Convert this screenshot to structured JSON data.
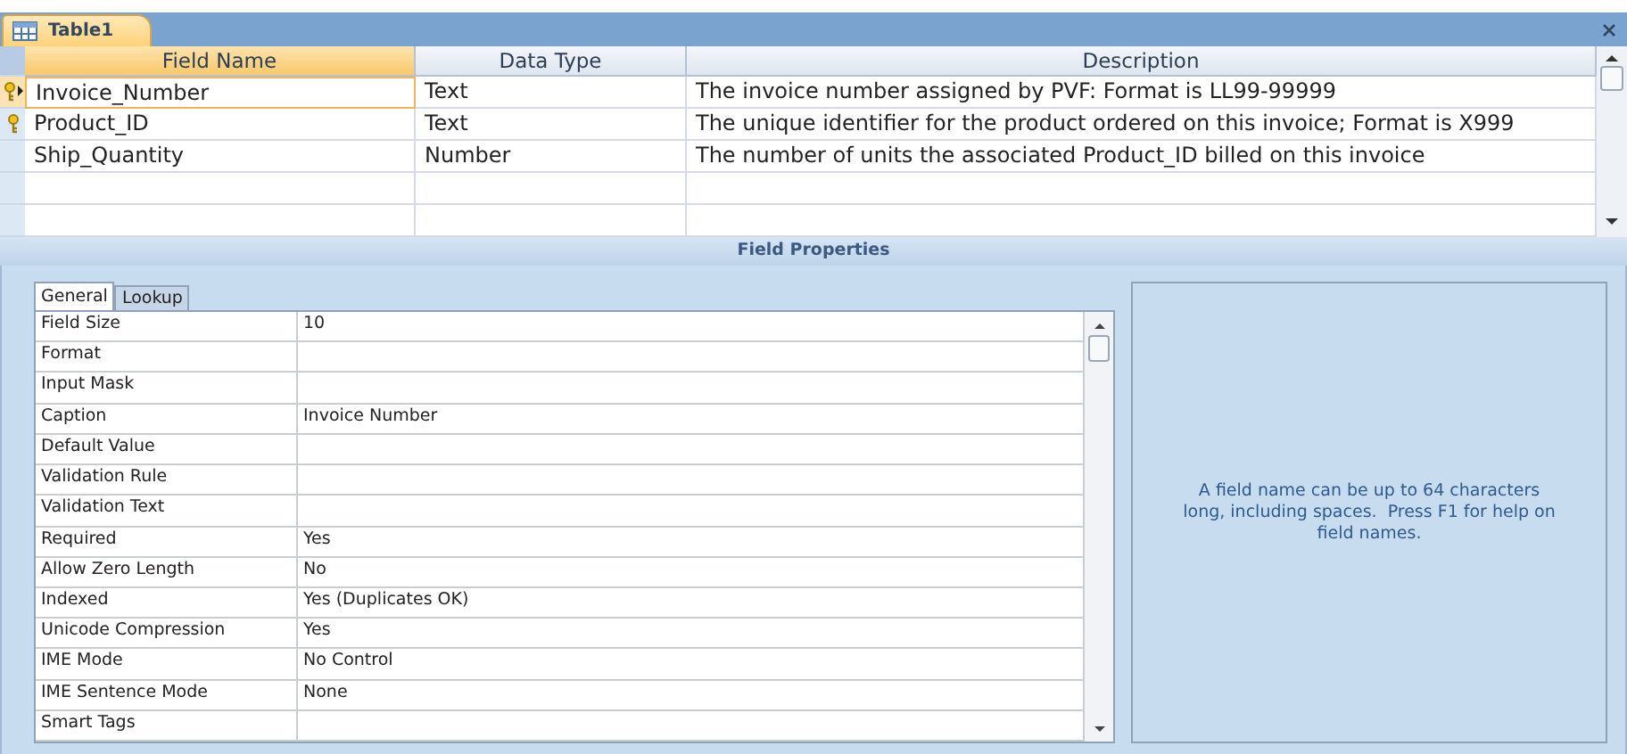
{
  "document_tab": {
    "title": "Table1"
  },
  "design_grid": {
    "columns": [
      "Field Name",
      "Data Type",
      "Description"
    ],
    "rows": [
      {
        "field_name": "Invoice_Number",
        "data_type": "Text",
        "description": "The invoice number assigned by PVF: Format is LL99-99999",
        "primary_key": true,
        "selected": true
      },
      {
        "field_name": "Product_ID",
        "data_type": "Text",
        "description": "The unique identifier for the product ordered on this invoice; Format is X999",
        "primary_key": true,
        "selected": false
      },
      {
        "field_name": "Ship_Quantity",
        "data_type": "Number",
        "description": "The number of units the associated Product_ID billed on this invoice",
        "primary_key": false,
        "selected": false
      }
    ]
  },
  "field_properties": {
    "title": "Field Properties",
    "tabs": [
      {
        "label": "General",
        "selected": true
      },
      {
        "label": "Lookup",
        "selected": false
      }
    ],
    "properties": [
      {
        "name": "Field Size",
        "value": "10"
      },
      {
        "name": "Format"
      },
      {
        "name": "Input Mask"
      },
      {
        "name": "Caption",
        "value": "Invoice Number"
      },
      {
        "name": "Default Value"
      },
      {
        "name": "Validation Rule"
      },
      {
        "name": "Validation Text"
      },
      {
        "name": "Required",
        "value": "Yes"
      },
      {
        "name": "Allow Zero Length",
        "value": "No"
      },
      {
        "name": "Indexed",
        "value": "Yes (Duplicates OK)"
      },
      {
        "name": "Unicode Compression",
        "value": "Yes"
      },
      {
        "name": "IME Mode",
        "value": "No Control"
      },
      {
        "name": "IME Sentence Mode",
        "value": "None"
      },
      {
        "name": "Smart Tags"
      }
    ],
    "help_text": "A field name can be up to 64 characters long, including spaces.  Press F1 for help on field names."
  }
}
